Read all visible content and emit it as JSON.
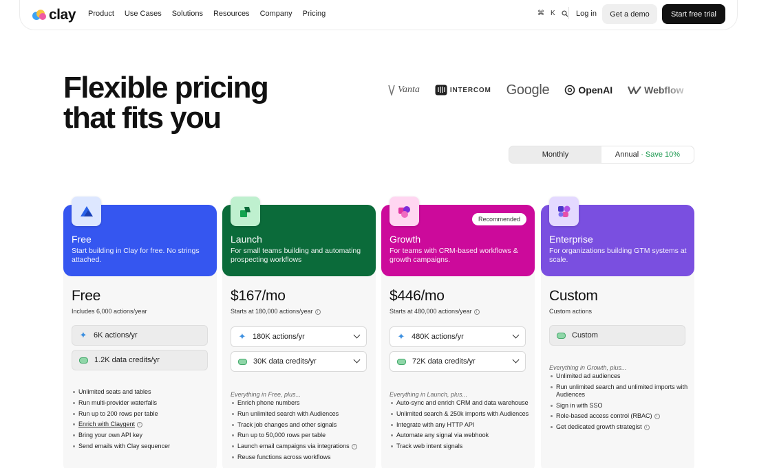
{
  "nav": {
    "logo_text": "clay",
    "links": [
      "Product",
      "Use Cases",
      "Solutions",
      "Resources",
      "Company",
      "Pricing"
    ],
    "shortcut_keys": [
      "⌘",
      "K"
    ],
    "login_label": "Log in",
    "demo_label": "Get a demo",
    "trial_label": "Start free trial"
  },
  "hero": {
    "title_line1": "Flexible pricing",
    "title_line2": "that fits you"
  },
  "customer_logos": [
    "Vanta",
    "INTERCOM",
    "Google",
    "OpenAI",
    "Webflow"
  ],
  "billing_toggle": {
    "monthly_label": "Monthly",
    "annual_label": "Annual",
    "save_label": "· Save 10%",
    "selected": "Monthly"
  },
  "plans": [
    {
      "name": "Free",
      "description": "Start building in Clay for free. No strings attached.",
      "header_color": "#3556f0",
      "icon_bg": "#dde7ff",
      "price": "Free",
      "price_sub": "Includes 6,000 actions/year",
      "selector_1": "6K actions/yr",
      "selector_2": "1.2K data credits/yr",
      "features_intro": "",
      "features": [
        "Unlimited seats and tables",
        "Run multi-provider waterfalls",
        "Run up to 200 rows per table",
        "Enrich with Claygent",
        "Bring your own API key",
        "Send emails with Clay sequencer"
      ]
    },
    {
      "name": "Launch",
      "description": "For small teams building and automating prospecting workflows",
      "header_color": "#0b6b3a",
      "icon_bg": "#bff0cf",
      "price": "$167/mo",
      "price_sub": "Starts at 180,000 actions/year",
      "selector_1": "180K actions/yr",
      "selector_2": "30K data credits/yr",
      "features_intro": "Everything in Free, plus...",
      "features": [
        "Enrich phone numbers",
        "Run unlimited search with Audiences",
        "Track job changes and other signals",
        "Run up to 50,000 rows per table",
        "Launch email campaigns via integrations",
        "Reuse functions across workflows"
      ]
    },
    {
      "name": "Growth",
      "badge": "Recommended",
      "description": "For teams with CRM-based workflows & growth campaigns.",
      "header_color": "#cc0a9b",
      "icon_bg": "#ffd6f1",
      "price": "$446/mo",
      "price_sub": "Starts at 480,000 actions/year",
      "selector_1": "480K actions/yr",
      "selector_2": "72K data credits/yr",
      "features_intro": "Everything in Launch, plus...",
      "features": [
        "Auto-sync and enrich CRM and data warehouse",
        "Unlimited search & 250k imports with Audiences",
        "Integrate with any HTTP API",
        "Automate any signal via webhook",
        "Track web intent signals"
      ]
    },
    {
      "name": "Enterprise",
      "description": "For organizations building GTM systems at scale.",
      "header_color": "#7a4fe0",
      "icon_bg": "#e4d9ff",
      "price": "Custom",
      "price_sub": "Custom actions",
      "selector_1": "Custom",
      "features_intro": "Everything in Growth, plus...",
      "features": [
        "Unlimited ad audiences",
        "Run unlimited search and unlimited imports with Audiences",
        "Sign in with SSO",
        "Role-based access control (RBAC)",
        "Get dedicated growth strategist"
      ]
    }
  ]
}
